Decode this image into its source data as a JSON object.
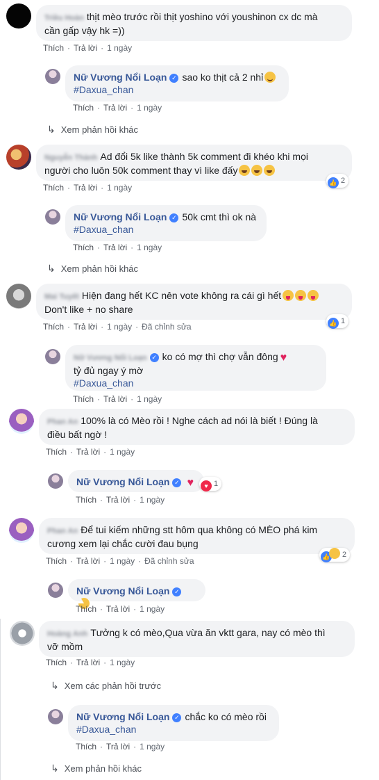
{
  "labels": {
    "like": "Thích",
    "reply": "Trả lời",
    "one_day": "1 ngày",
    "edited": "Đã chỉnh sửa",
    "more_replies": "Xem phản hồi khác",
    "prev_replies": "Xem các phản hồi trước"
  },
  "page_name": "Nữ Vương Nổi Loạn",
  "hashtag": "#Daxua_chan",
  "comments": [
    {
      "author": "Triều Hoàn",
      "text1": "thịt mèo trước rồi thịt yoshino với youshinon cx dc mà",
      "text2": "cần gấp vậy hk =))"
    },
    {
      "author": "Nguyễn Thành",
      "text1": "Ad đổi 5k like thành 5k comment đi khéo khi mọi",
      "text2": "người cho luôn 50k comment thay vì like đấy",
      "reactions": "2"
    },
    {
      "author": "Mai Tuyết",
      "text1": "Hiện đang hết KC nên vote không ra cái gì hết",
      "text2": "Don't like + no share",
      "reactions": "1"
    },
    {
      "author": "Phan An",
      "text1": "100% là có Mèo rồi ! Nghe cách ad nói là biết ! Đúng là",
      "text2": "điều bất ngờ !"
    },
    {
      "author": "Phan An",
      "text1": "Để tui kiếm những stt hôm qua không có MÈO phá kim",
      "text2": "cương xem lại chắc cười đau bụng",
      "reactions": "2"
    },
    {
      "author": "Hoàng Anh",
      "text1": "Tưởng k có mèo,Qua vừa ăn vktt gara, nay có mèo thì",
      "text2": "vỡ mồm"
    }
  ],
  "replies": [
    {
      "text1": "sao ko thịt cả 2 nhỉ"
    },
    {
      "text1": "50k cmt thì ok nà"
    },
    {
      "author_blur": "Nữ Vương Nổi Loạn",
      "text1": "ko có mợ thì chợ vẫn đông",
      "text2": "tỷ đủ ngay ý mờ"
    },
    {
      "reactions": "1"
    },
    {},
    {
      "text1": "chắc ko có mèo rồi"
    }
  ]
}
